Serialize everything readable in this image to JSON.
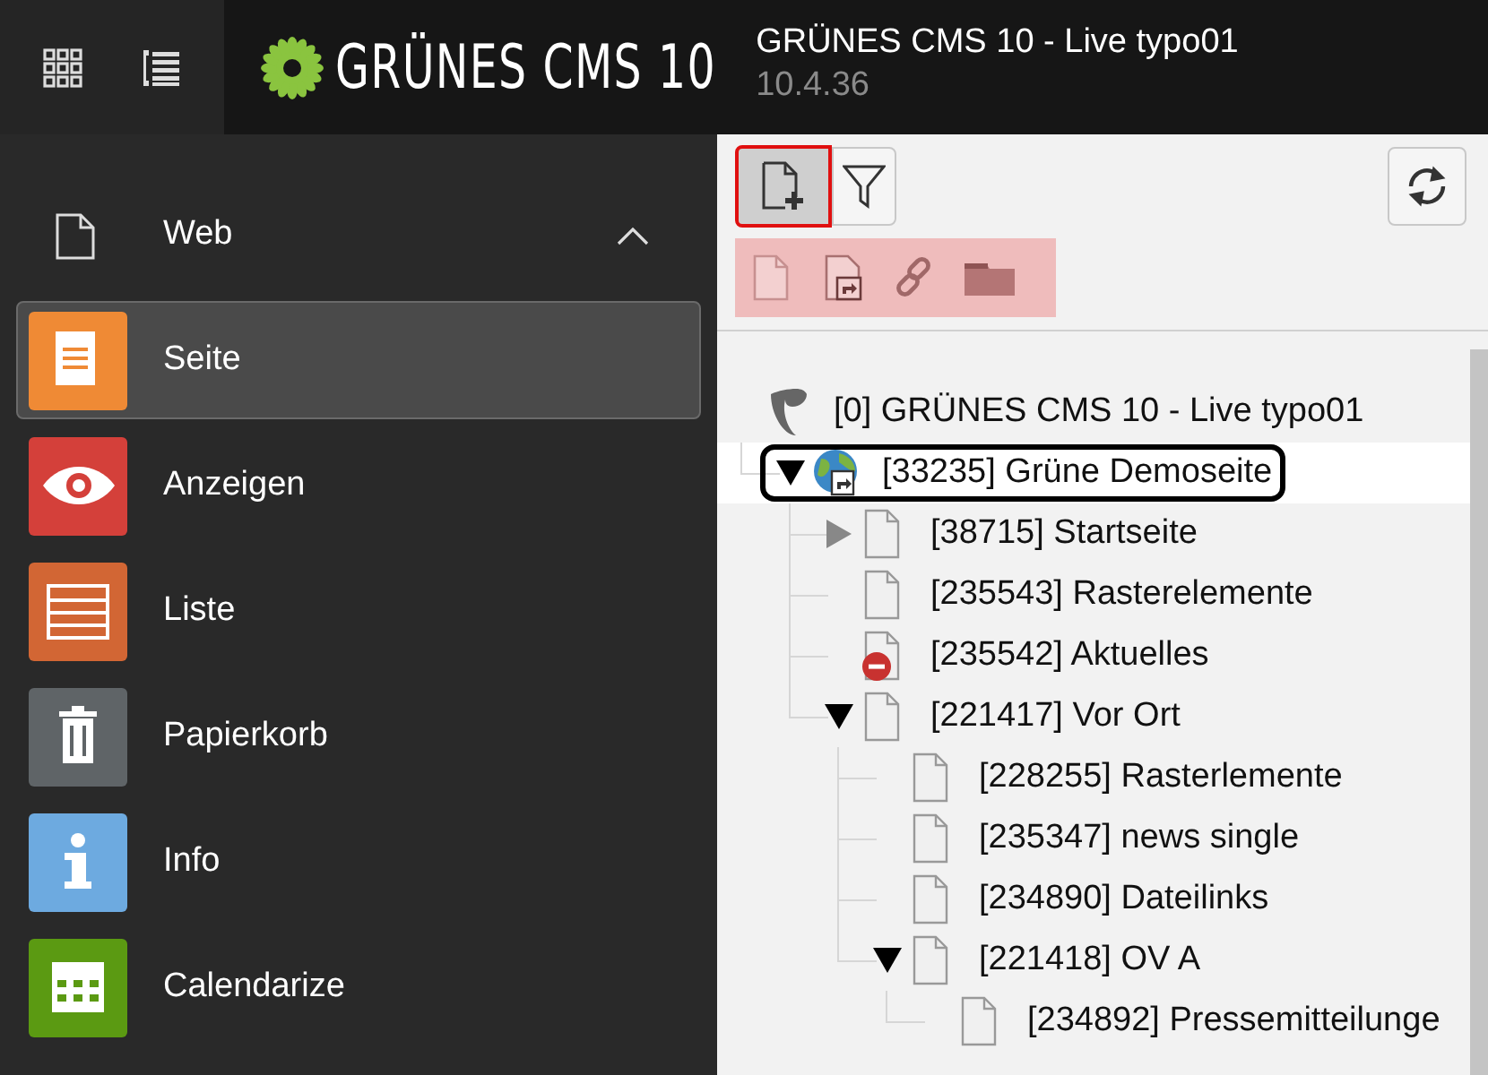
{
  "topbar": {
    "logo_text": "GRÜNES CMS 10",
    "site_title": "GRÜNES CMS 10 - Live typo01",
    "version": "10.4.36"
  },
  "sidebar": {
    "group": {
      "label": "Web",
      "expanded": true
    },
    "modules": [
      {
        "label": "Seite",
        "kind": "page",
        "color": "#ef8a35",
        "selected": true
      },
      {
        "label": "Anzeigen",
        "kind": "view",
        "color": "#d4403a",
        "selected": false
      },
      {
        "label": "Liste",
        "kind": "list",
        "color": "#d26634",
        "selected": false
      },
      {
        "label": "Papierkorb",
        "kind": "trash",
        "color": "#5f6467",
        "selected": false
      },
      {
        "label": "Info",
        "kind": "info",
        "color": "#6daae0",
        "selected": false
      },
      {
        "label": "Calendarize",
        "kind": "calendar",
        "color": "#5b9a12",
        "selected": false
      }
    ]
  },
  "toolbar": {
    "new_page": {
      "selected": true
    },
    "filter": {
      "selected": false
    },
    "dragbar": [
      {
        "kind": "page"
      },
      {
        "kind": "shortcut"
      },
      {
        "kind": "link"
      },
      {
        "kind": "folder"
      }
    ]
  },
  "tree": [
    {
      "label": "[0] GRÜNES CMS 10 - Live typo01",
      "kind": "root",
      "selected": false,
      "children": [
        {
          "label": "[33235] Grüne Demoseite",
          "kind": "site",
          "selected": true,
          "expanded": true,
          "children": [
            {
              "label": "[38715] Startseite",
              "kind": "page",
              "selected": false,
              "expanded": false
            },
            {
              "label": "[235543] Rasterelemente",
              "kind": "page",
              "selected": false
            },
            {
              "label": "[235542] Aktuelles",
              "kind": "page",
              "selected": false,
              "hidden": true
            },
            {
              "label": "[221417] Vor Ort",
              "kind": "page",
              "selected": false,
              "expanded": true,
              "children": [
                {
                  "label": "[228255] Rasterlemente",
                  "kind": "page",
                  "selected": false
                },
                {
                  "label": "[235347] news single",
                  "kind": "page",
                  "selected": false
                },
                {
                  "label": "[234890] Dateilinks",
                  "kind": "page",
                  "selected": false
                },
                {
                  "label": "[221418] OV A",
                  "kind": "page",
                  "selected": false,
                  "expanded": true,
                  "children": [
                    {
                      "label": "[234892] Pressemitteilunge",
                      "kind": "page",
                      "selected": false
                    }
                  ]
                }
              ]
            }
          ]
        }
      ]
    }
  ]
}
